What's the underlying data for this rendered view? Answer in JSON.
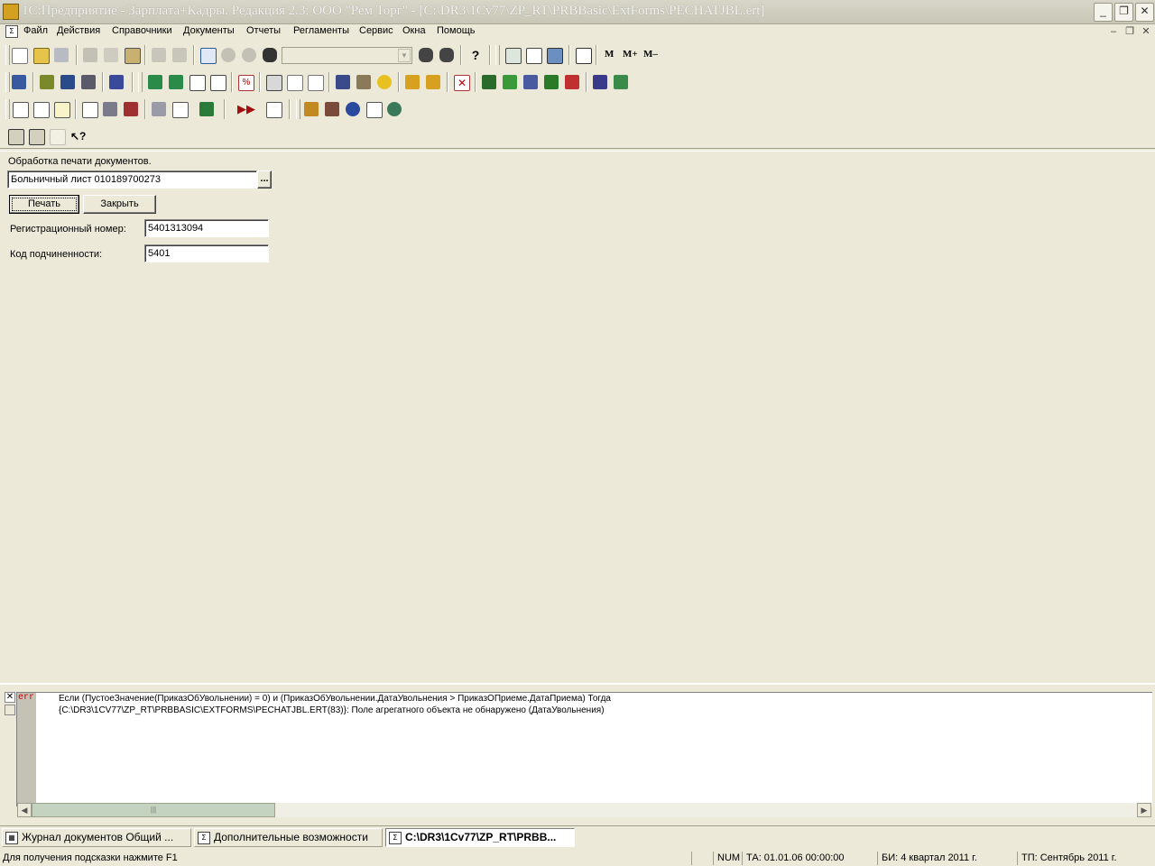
{
  "window": {
    "title": "1С:Предприятие - Зарплата+Кадры. Редакция 2.3: ООО \"Рем Торг\" - [C:\\DR3\\1Cv77\\ZP_RT\\PRBBasic\\ExtForms\\PECHATJBL.ert]",
    "minimize": "_",
    "maximize": "❐",
    "close": "✕"
  },
  "menu": {
    "items": [
      "Файл",
      "Действия",
      "Справочники",
      "Документы",
      "Отчеты",
      "Регламенты",
      "Сервис",
      "Окна",
      "Помощь"
    ],
    "mdi_minimize": "–",
    "mdi_restore": "❐",
    "mdi_close": "✕"
  },
  "toolbar": {
    "m_label": "M",
    "m_plus_label": "M+",
    "m_minus_label": "M–",
    "search_combo_value": ""
  },
  "form": {
    "caption": "Обработка печати документов.",
    "document_value": "Больничный лист 010189700273",
    "select_button": "...",
    "print_button": "Печать",
    "close_button": "Закрыть",
    "reg_number_label": "Регистрационный номер:",
    "reg_number_value": "5401313094",
    "subordination_label": "Код подчиненности:",
    "subordination_value": "5401"
  },
  "messages": {
    "close": "✕",
    "tag": "err",
    "line1": "Если (ПустоеЗначение(ПриказОбУвольнении) = 0) и (ПриказОбУвольнении.ДатаУвольнения > ПриказОПриеме.ДатаПриема) Тогда",
    "line2": "{C:\\DR3\\1CV77\\ZP_RT\\PRBBASIC\\EXTFORMS\\PECHATJBL.ERT(83)}: Поле агрегатного объекта не обнаружено (ДатаУвольнения)",
    "scroll_left": "◀",
    "scroll_right": "▶",
    "thumb_grip": "|||"
  },
  "window_tabs": [
    {
      "label": "Журнал документов  Общий ...",
      "active": false
    },
    {
      "label": "Дополнительные возможности",
      "active": false
    },
    {
      "label": "C:\\DR3\\1Cv77\\ZP_RT\\PRBB...",
      "active": true
    }
  ],
  "statusbar": {
    "hint": "Для получения подсказки нажмите F1",
    "num": "NUM",
    "ta": "ТА: 01.01.06  00:00:00",
    "bi": "БИ: 4 квартал 2011 г.",
    "tp": "ТП: Сентябрь 2011 г."
  },
  "colors": {
    "face": "#ece9d8",
    "error_tag": "#d00000"
  }
}
